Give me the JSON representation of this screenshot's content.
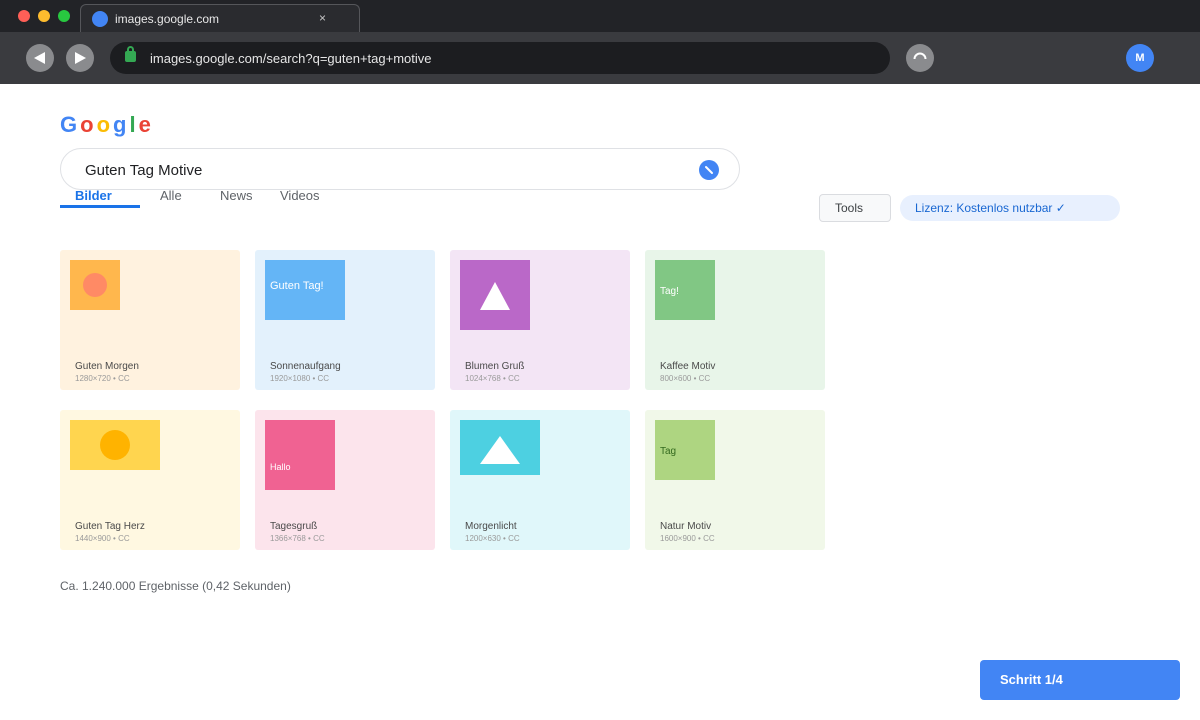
{
  "browser": {
    "tab_title": "images.google.com",
    "tab_close": "×",
    "url": "images.google.com/search?q=guten+tag+motive",
    "avatar_initial": "M"
  },
  "logo": {
    "letters": [
      "G",
      "o",
      "o",
      "g",
      "l",
      "e"
    ],
    "colors": [
      "#4285f4",
      "#ea4335",
      "#fbbc05",
      "#4285f4",
      "#34a853",
      "#ea4335"
    ]
  },
  "search": {
    "query": "Guten Tag Motive"
  },
  "tabs": [
    {
      "label": "Bilder",
      "active": true
    },
    {
      "label": "Alle",
      "active": false
    },
    {
      "label": "News",
      "active": false
    },
    {
      "label": "Videos",
      "active": false
    }
  ],
  "filters": {
    "tools_label": "Tools",
    "license_label": "Lizenz: Kostenlos nutzbar ✓"
  },
  "results": [
    {
      "title": "Guten Morgen",
      "meta": "1280×720 • CC",
      "thumb_text": "",
      "card_bg": "#fff2df",
      "thumb_color": "#ffb74d",
      "shape": "circle",
      "shape_color": "#ff8a65"
    },
    {
      "title": "Sonnenaufgang",
      "meta": "1920×1080 • CC",
      "thumb_text": "Guten Tag!",
      "card_bg": "#e3f1fc",
      "thumb_color": "#64b5f6",
      "shape": "none",
      "shape_color": ""
    },
    {
      "title": "Blumen Gruß",
      "meta": "1024×768 • CC",
      "thumb_text": "",
      "card_bg": "#f3e5f5",
      "thumb_color": "#ba68c8",
      "shape": "triangle",
      "shape_color": "#ffffff"
    },
    {
      "title": "Kaffee Motiv",
      "meta": "800×600 • CC",
      "thumb_text": "Tag!",
      "card_bg": "#e8f5e9",
      "thumb_color": "#81c784",
      "shape": "none",
      "shape_color": ""
    },
    {
      "title": "Guten Tag Herz",
      "meta": "1440×900 • CC",
      "thumb_text": "",
      "card_bg": "#fff8e1",
      "thumb_color": "#ffd54f",
      "shape": "circle",
      "shape_color": "#ffb300"
    },
    {
      "title": "Tagesgruß",
      "meta": "1366×768 • CC",
      "thumb_text": "Hallo",
      "card_bg": "#fce4ec",
      "thumb_color": "#f06292",
      "shape": "none",
      "shape_color": ""
    },
    {
      "title": "Morgenlicht",
      "meta": "1200×630 • CC",
      "thumb_text": "",
      "card_bg": "#e0f7fa",
      "thumb_color": "#4dd0e1",
      "shape": "triangle",
      "shape_color": "#ffffff"
    },
    {
      "title": "Natur Motiv",
      "meta": "1600×900 • CC",
      "thumb_text": "Tag",
      "card_bg": "#f1f8e9",
      "thumb_color": "#aed581",
      "shape": "none",
      "shape_color": ""
    }
  ],
  "result_stats": "Ca. 1.240.000 Ergebnisse (0,42 Sekunden)",
  "step_button": "Schritt 1/4"
}
